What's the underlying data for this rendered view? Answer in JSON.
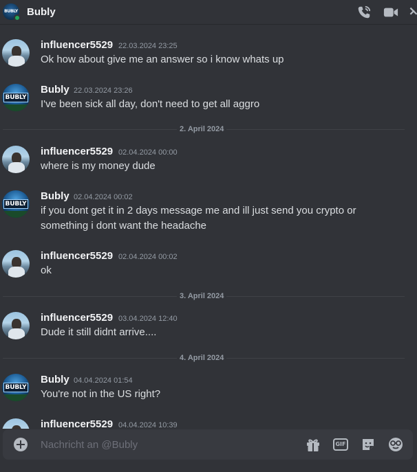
{
  "header": {
    "title": "Bubly",
    "avatar_text": "BUBLY",
    "status": "online",
    "icons": [
      "phone-call-icon",
      "video-call-icon",
      "pin-icon"
    ]
  },
  "messages": [
    {
      "author": "influencer5529",
      "timestamp": "22.03.2024 23:25",
      "text": [
        "Ok how about give me an answer so i know whats up"
      ],
      "avatar": "user"
    },
    {
      "author": "Bubly",
      "timestamp": "22.03.2024 23:26",
      "text": [
        "I've been sick all day, don't need to get all aggro"
      ],
      "avatar": "bubly"
    },
    {
      "author": "influencer5529",
      "timestamp": "02.04.2024 00:00",
      "text": [
        "where is my money dude"
      ],
      "avatar": "user"
    },
    {
      "author": "Bubly",
      "timestamp": "02.04.2024 00:02",
      "text": [
        "if you dont get it in 2 days message me and ill just send you crypto or",
        "something i dont want the headache"
      ],
      "avatar": "bubly"
    },
    {
      "author": "influencer5529",
      "timestamp": "02.04.2024 00:02",
      "text": [
        "ok"
      ],
      "avatar": "user"
    },
    {
      "author": "influencer5529",
      "timestamp": "03.04.2024 12:40",
      "text": [
        "Dude it still didnt arrive...."
      ],
      "avatar": "user"
    },
    {
      "author": "Bubly",
      "timestamp": "04.04.2024 01:54",
      "text": [
        "You're not in the US right?"
      ],
      "avatar": "bubly"
    },
    {
      "author": "influencer5529",
      "timestamp": "04.04.2024 10:39",
      "text": [
        ""
      ],
      "avatar": "user"
    }
  ],
  "dividers": [
    "2. April 2024",
    "3. April 2024",
    "4. April 2024"
  ],
  "composer": {
    "placeholder": "Nachricht an @Bubly",
    "gif_label": "GIF",
    "icons": [
      "add-attachment-icon",
      "gift-icon",
      "gif-icon",
      "sticker-icon",
      "emoji-icon"
    ]
  },
  "colors": {
    "background": "#313338",
    "composer": "#383a40",
    "online": "#23a55a",
    "text": "#dbdee1",
    "muted": "#949ba4"
  }
}
